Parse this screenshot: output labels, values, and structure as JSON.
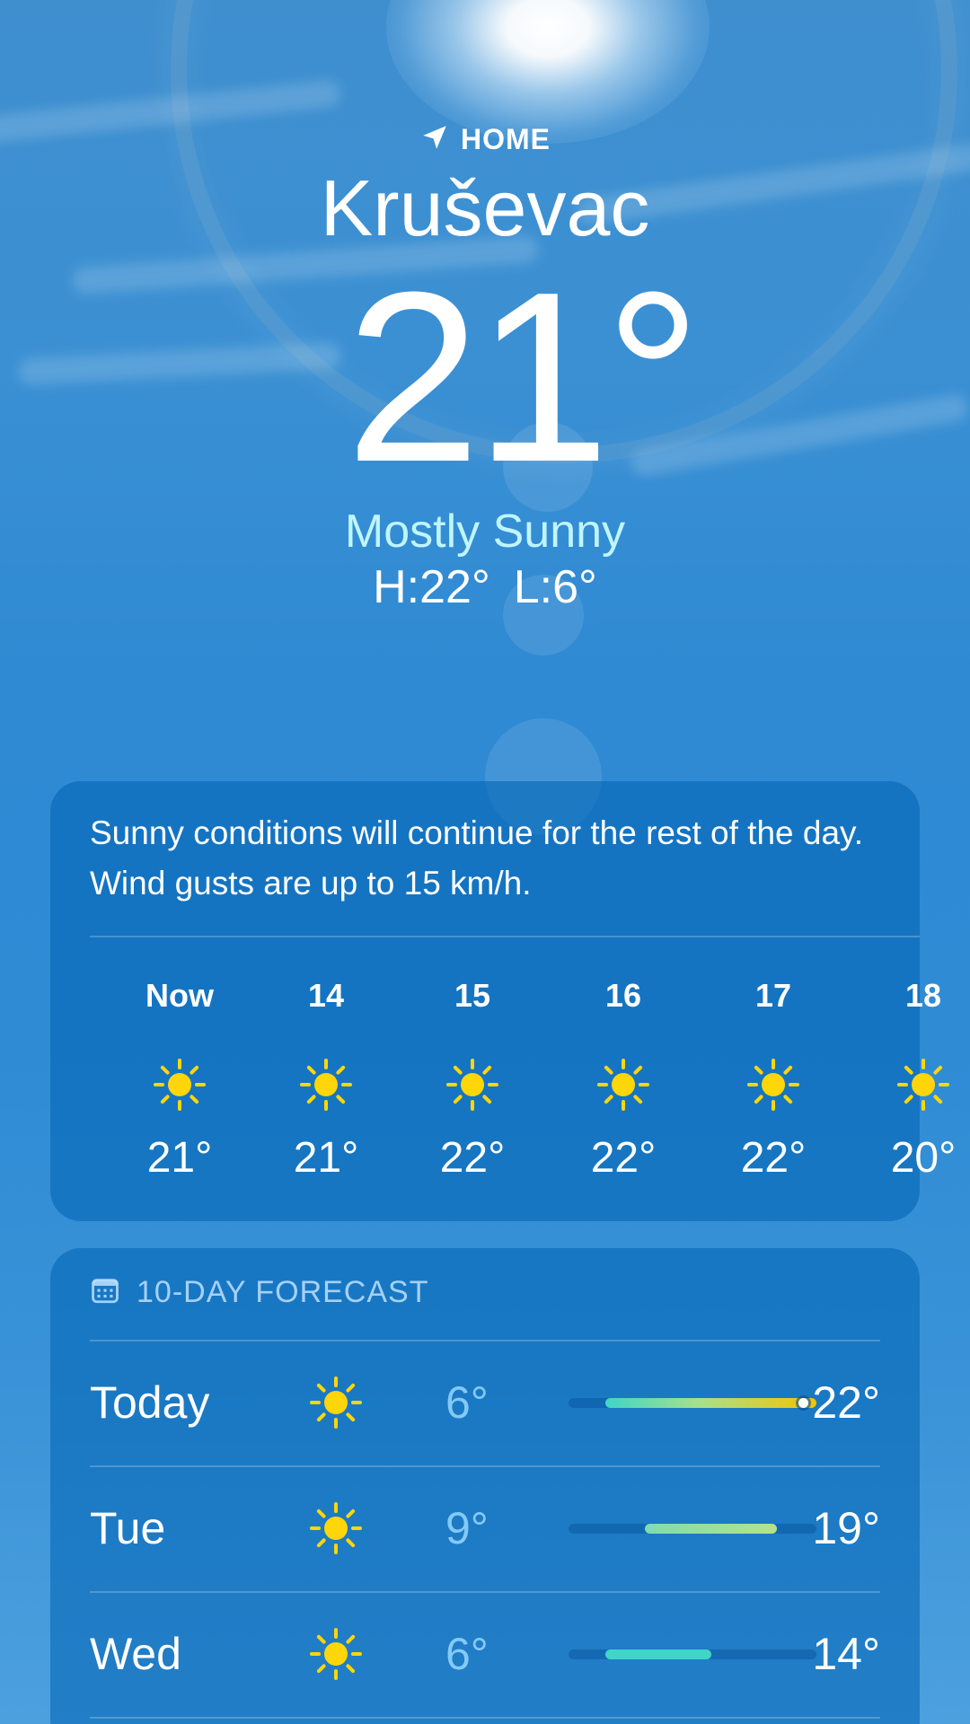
{
  "location": {
    "label": "HOME",
    "icon": "location-arrow-icon",
    "city": "Kruševac"
  },
  "current": {
    "temperature": "21°",
    "condition": "Mostly Sunny",
    "high": "H:22°",
    "low": "L:6°"
  },
  "hourly_card": {
    "summary": "Sunny conditions will continue for the rest of the day. Wind gusts are up to 15 km/h.",
    "hours": [
      {
        "time": "Now",
        "icon": "sun-icon",
        "temp": "21°"
      },
      {
        "time": "14",
        "icon": "sun-icon",
        "temp": "21°"
      },
      {
        "time": "15",
        "icon": "sun-icon",
        "temp": "22°"
      },
      {
        "time": "16",
        "icon": "sun-icon",
        "temp": "22°"
      },
      {
        "time": "17",
        "icon": "sun-icon",
        "temp": "22°"
      },
      {
        "time": "18",
        "icon": "sun-icon",
        "temp": "20°"
      }
    ]
  },
  "forecast_card": {
    "title": "10-DAY FORECAST",
    "icon": "calendar-icon",
    "scale_min": 6,
    "scale_max": 22,
    "days": [
      {
        "day": "Today",
        "icon": "sun-icon",
        "low": "6°",
        "high": "22°",
        "low_value": 6,
        "high_value": 22,
        "current_value": 21
      },
      {
        "day": "Tue",
        "icon": "sun-icon",
        "low": "9°",
        "high": "19°",
        "low_value": 9,
        "high_value": 19
      },
      {
        "day": "Wed",
        "icon": "sun-icon",
        "low": "6°",
        "high": "14°",
        "low_value": 6,
        "high_value": 14
      }
    ]
  },
  "colors": {
    "sun": "#ffd60a",
    "condition_text": "#bff5ff",
    "bar_cool": "#3fd6c8",
    "bar_warm": "#f5c400"
  }
}
